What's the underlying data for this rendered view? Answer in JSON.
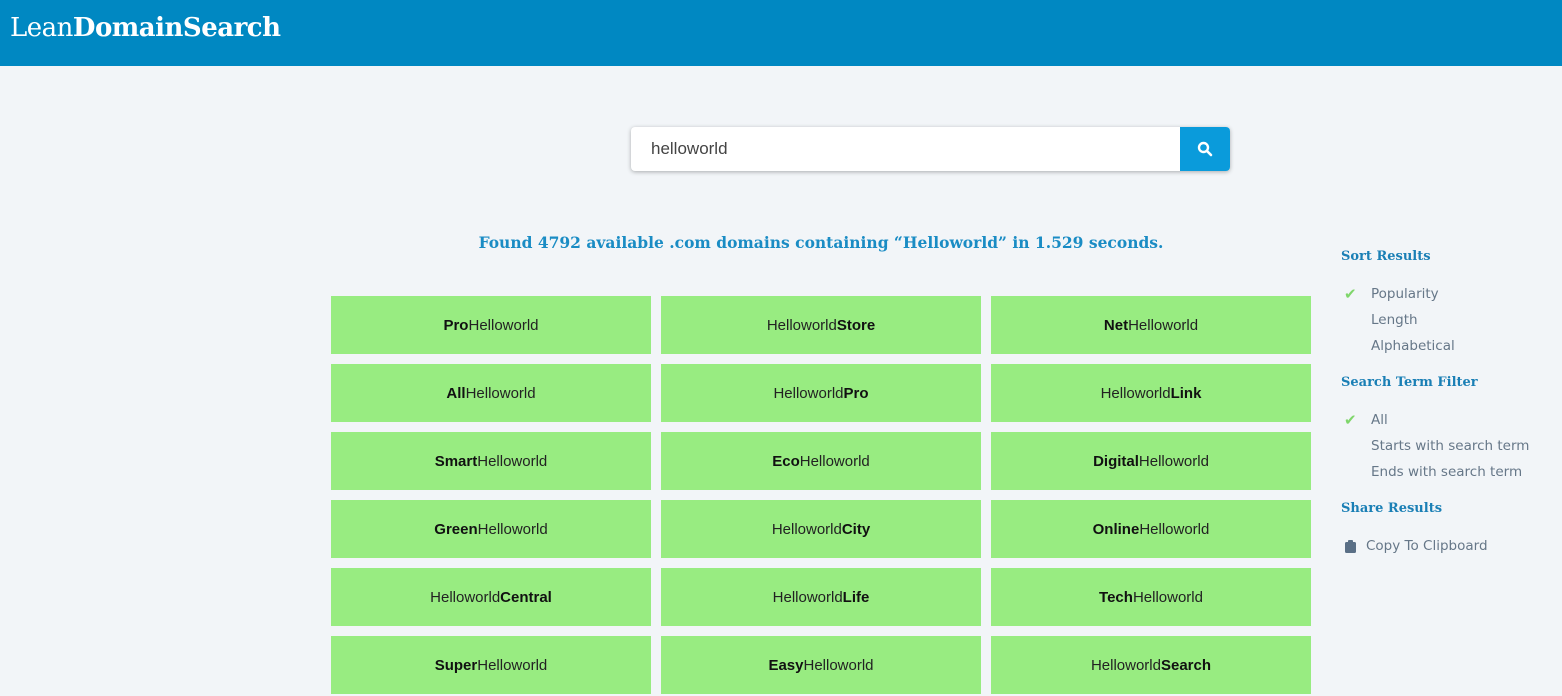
{
  "header": {
    "logo_light": "Lean",
    "logo_bold": "DomainSearch"
  },
  "search": {
    "value": "helloworld",
    "button_icon": "search-icon"
  },
  "summary": "Found 4792 available .com domains containing “Helloworld” in 1.529 seconds.",
  "results": [
    {
      "pre": "Pro",
      "term": "Helloworld",
      "post": "",
      "bold": "pre"
    },
    {
      "pre": "",
      "term": "Helloworld",
      "post": "Store",
      "bold": "post"
    },
    {
      "pre": "Net",
      "term": "Helloworld",
      "post": "",
      "bold": "pre"
    },
    {
      "pre": "All",
      "term": "Helloworld",
      "post": "",
      "bold": "pre"
    },
    {
      "pre": "",
      "term": "Helloworld",
      "post": "Pro",
      "bold": "post"
    },
    {
      "pre": "",
      "term": "Helloworld",
      "post": "Link",
      "bold": "post"
    },
    {
      "pre": "Smart",
      "term": "Helloworld",
      "post": "",
      "bold": "pre"
    },
    {
      "pre": "Eco",
      "term": "Helloworld",
      "post": "",
      "bold": "pre"
    },
    {
      "pre": "Digital",
      "term": "Helloworld",
      "post": "",
      "bold": "pre"
    },
    {
      "pre": "Green",
      "term": "Helloworld",
      "post": "",
      "bold": "pre"
    },
    {
      "pre": "",
      "term": "Helloworld",
      "post": "City",
      "bold": "post"
    },
    {
      "pre": "Online",
      "term": "Helloworld",
      "post": "",
      "bold": "pre"
    },
    {
      "pre": "",
      "term": "Helloworld",
      "post": "Central",
      "bold": "post"
    },
    {
      "pre": "",
      "term": "Helloworld",
      "post": "Life",
      "bold": "post"
    },
    {
      "pre": "Tech",
      "term": "Helloworld",
      "post": "",
      "bold": "pre"
    },
    {
      "pre": "Super",
      "term": "Helloworld",
      "post": "",
      "bold": "pre"
    },
    {
      "pre": "Easy",
      "term": "Helloworld",
      "post": "",
      "bold": "pre"
    },
    {
      "pre": "",
      "term": "Helloworld",
      "post": "Search",
      "bold": "post"
    }
  ],
  "sidebar": {
    "sort": {
      "title": "Sort Results",
      "options": [
        {
          "label": "Popularity",
          "checked": true
        },
        {
          "label": "Length",
          "checked": false
        },
        {
          "label": "Alphabetical",
          "checked": false
        }
      ]
    },
    "filter": {
      "title": "Search Term Filter",
      "options": [
        {
          "label": "All",
          "checked": true
        },
        {
          "label": "Starts with search term",
          "checked": false
        },
        {
          "label": "Ends with search term",
          "checked": false
        }
      ]
    },
    "share": {
      "title": "Share Results",
      "copy_label": "Copy To Clipboard"
    }
  },
  "colors": {
    "brand": "#0088c2",
    "result_bg": "#98ec81",
    "check": "#7fd66b"
  }
}
